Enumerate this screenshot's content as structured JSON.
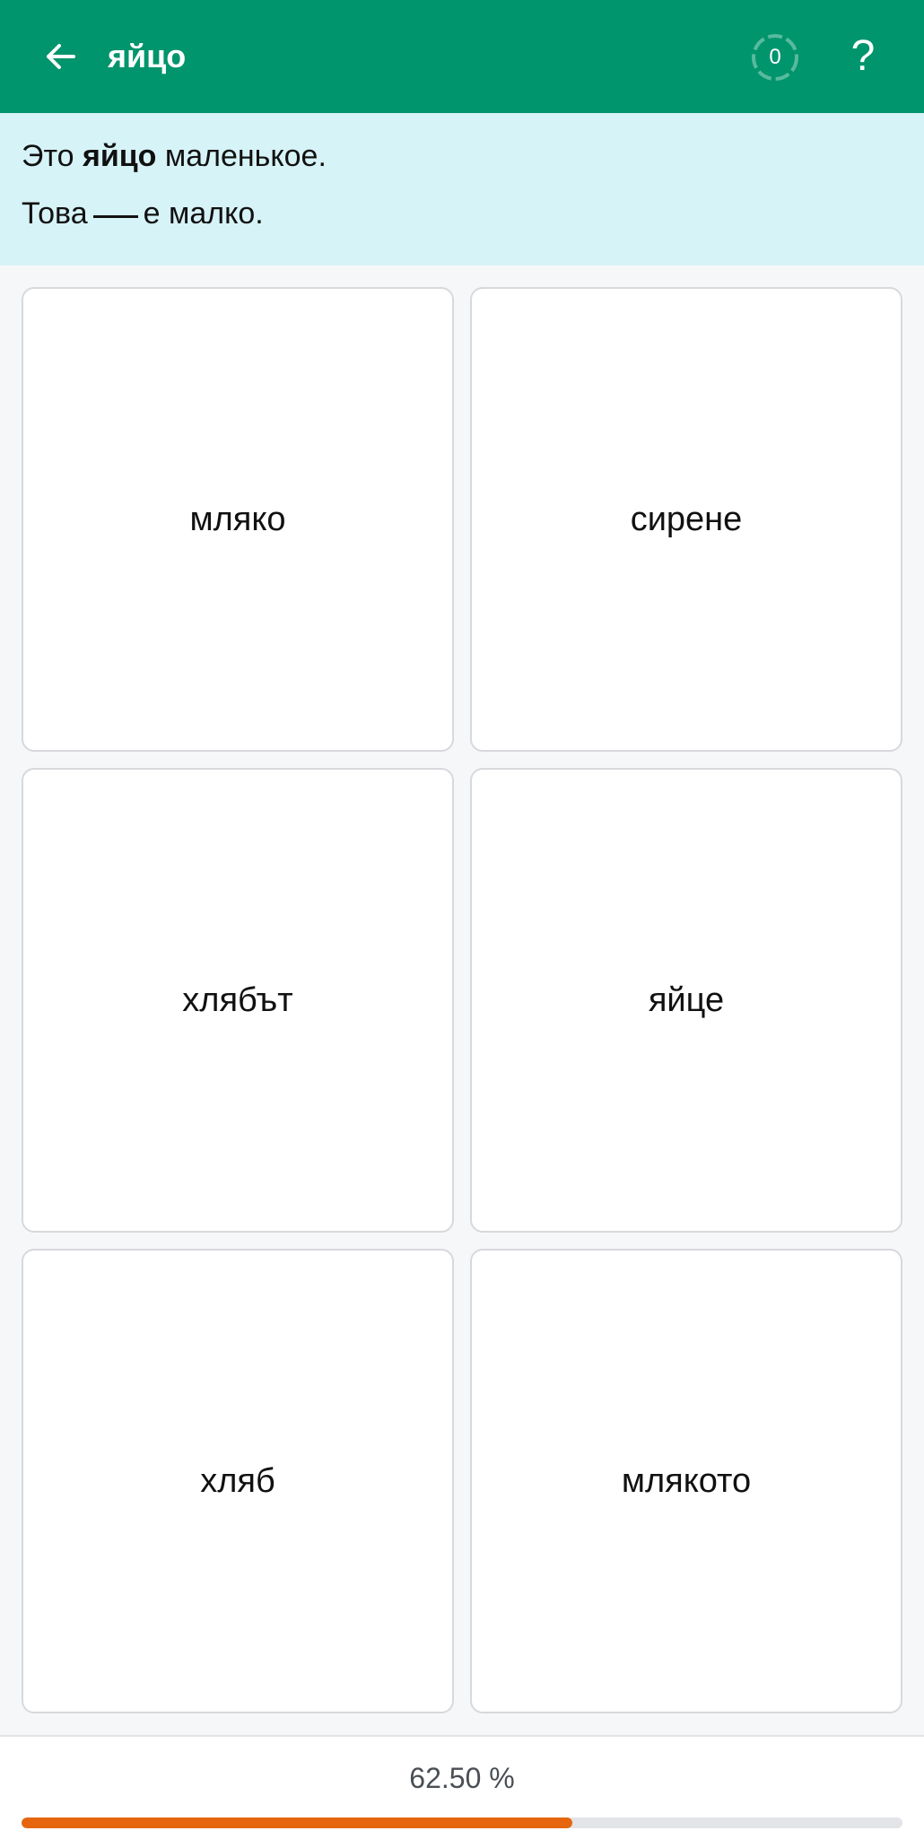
{
  "header": {
    "title": "яйцо",
    "counter": "0",
    "help": "?"
  },
  "prompt": {
    "line1_before": "Это ",
    "line1_bold": "яйцо",
    "line1_after": " маленькое.",
    "line2_before": "Това",
    "line2_after": "е малко."
  },
  "options": [
    {
      "label": "мляко"
    },
    {
      "label": "сирене"
    },
    {
      "label": "хлябът"
    },
    {
      "label": "яйце"
    },
    {
      "label": "хляб"
    },
    {
      "label": "млякото"
    }
  ],
  "progress": {
    "text": "62.50 %",
    "fraction": 0.625,
    "fill_color": "#e5660e",
    "track_color": "#e3e4e8"
  },
  "colors": {
    "header_bg": "#00956c",
    "banner_bg": "#d6f3f7"
  },
  "icons": {
    "back": "arrow-left-icon",
    "counter": "progress-ring-icon",
    "help": "question-mark-icon"
  }
}
